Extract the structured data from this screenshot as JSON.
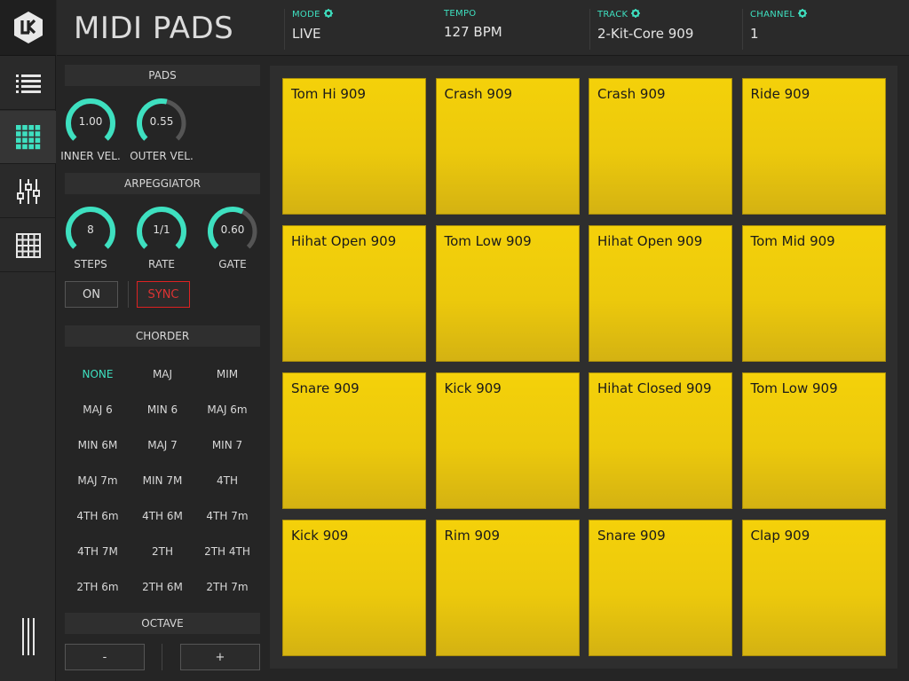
{
  "app": {
    "title": "MIDI PADS"
  },
  "sidebar": {
    "logo": "lk-logo-icon",
    "items": [
      {
        "name": "list-icon"
      },
      {
        "name": "pad-grid-icon",
        "active": true
      },
      {
        "name": "mixer-icon"
      },
      {
        "name": "sequencer-grid-icon"
      }
    ],
    "bottom": "vertical-lines-icon"
  },
  "header": {
    "fields": [
      {
        "label": "MODE",
        "value": "LIVE",
        "has_gear": true
      },
      {
        "label": "TEMPO",
        "value": "127 BPM",
        "has_gear": false
      },
      {
        "label": "TRACK",
        "value": "2-Kit-Core 909",
        "has_gear": true
      },
      {
        "label": "CHANNEL",
        "value": "1",
        "has_gear": true
      }
    ]
  },
  "pads_section": {
    "title": "PADS",
    "knobs": [
      {
        "label": "INNER VEL.",
        "value": "1.00",
        "level": 1.0
      },
      {
        "label": "OUTER VEL.",
        "value": "0.55",
        "level": 0.55
      }
    ]
  },
  "arpeggiator": {
    "title": "ARPEGGIATOR",
    "knobs": [
      {
        "label": "STEPS",
        "value": "8",
        "level": 1.0
      },
      {
        "label": "RATE",
        "value": "1/1",
        "level": 1.0
      },
      {
        "label": "GATE",
        "value": "0.60",
        "level": 0.6
      }
    ],
    "on_label": "ON",
    "sync_label": "SYNC"
  },
  "chorder": {
    "title": "CHORDER",
    "items": [
      "NONE",
      "MAJ",
      "MIM",
      "MAJ 6",
      "MIN 6",
      "MAJ 6m",
      "MIN 6M",
      "MAJ 7",
      "MIN 7",
      "MAJ 7m",
      "MIN 7M",
      "4TH",
      "4TH 6m",
      "4TH 6M",
      "4TH 7m",
      "4TH 7M",
      "2TH",
      "2TH 4TH",
      "2TH 6m",
      "2TH 6M",
      "2TH 7m"
    ],
    "selected": "NONE"
  },
  "octave": {
    "title": "OCTAVE",
    "minus_label": "-",
    "plus_label": "+"
  },
  "pads": [
    "Tom Hi 909",
    "Crash 909",
    "Crash 909",
    "Ride 909",
    "Hihat Open 909",
    "Tom Low 909",
    "Hihat Open 909",
    "Tom Mid 909",
    "Snare 909",
    "Kick 909",
    "Hihat Closed 909",
    "Tom Low 909",
    "Kick 909",
    "Rim 909",
    "Snare 909",
    "Clap 909"
  ],
  "colors": {
    "accent": "#3ee0c0",
    "pad": "#f0cd0c",
    "sync": "#dd2222",
    "knob_track": "#555555"
  }
}
